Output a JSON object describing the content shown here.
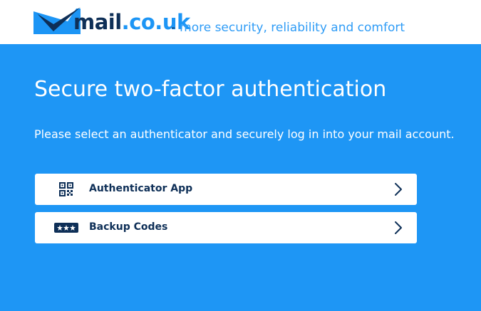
{
  "header": {
    "logo": {
      "part_a": "mail",
      "part_b": ".co.uk",
      "icon": "checkmark-envelope-icon"
    },
    "tagline_dash": "-",
    "tagline": "more security, reliability and comfort"
  },
  "main": {
    "title": "Secure two-factor authentication",
    "subtitle": "Please select an authenticator and securely log in into your mail account.",
    "options": [
      {
        "label": "Authenticator App",
        "icon": "qr-code-icon"
      },
      {
        "label": "Backup Codes",
        "icon": "password-dots-icon"
      }
    ]
  },
  "colors": {
    "brand_dark": "#0e2f57",
    "brand_blue": "#1c95f5",
    "background_blue": "#1e96f5",
    "card": "#ffffff"
  }
}
